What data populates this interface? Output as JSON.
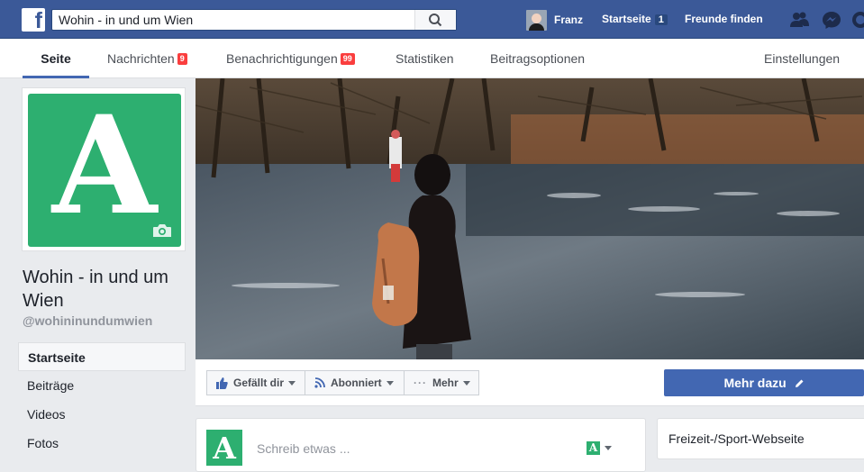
{
  "topbar": {
    "search_value": "Wohin - in und um Wien",
    "user_name": "Franz",
    "home_label": "Startseite",
    "home_count": "1",
    "find_friends_label": "Freunde finden",
    "brand_color": "#3b5998"
  },
  "subnav": {
    "tabs": [
      {
        "label": "Seite",
        "badge": ""
      },
      {
        "label": "Nachrichten",
        "badge": "9"
      },
      {
        "label": "Benachrichtigungen",
        "badge": "99"
      },
      {
        "label": "Statistiken",
        "badge": ""
      },
      {
        "label": "Beitragsoptionen",
        "badge": ""
      }
    ],
    "settings_label": "Einstellungen"
  },
  "page": {
    "profile_letter": "A",
    "name": "Wohin - in und um Wien",
    "handle": "@wohininundumwien",
    "accent_color": "#2daf70"
  },
  "sidebar": {
    "items": [
      {
        "label": "Startseite"
      },
      {
        "label": "Beiträge"
      },
      {
        "label": "Videos"
      },
      {
        "label": "Fotos"
      }
    ]
  },
  "actions": {
    "like_label": "Gefällt dir",
    "follow_label": "Abonniert",
    "more_label": "Mehr",
    "cta_label": "Mehr dazu"
  },
  "composer": {
    "placeholder": "Schreib etwas ...",
    "avatar_letter": "A",
    "switch_letter": "A"
  },
  "category": {
    "label": "Freizeit-/Sport-Webseite"
  }
}
